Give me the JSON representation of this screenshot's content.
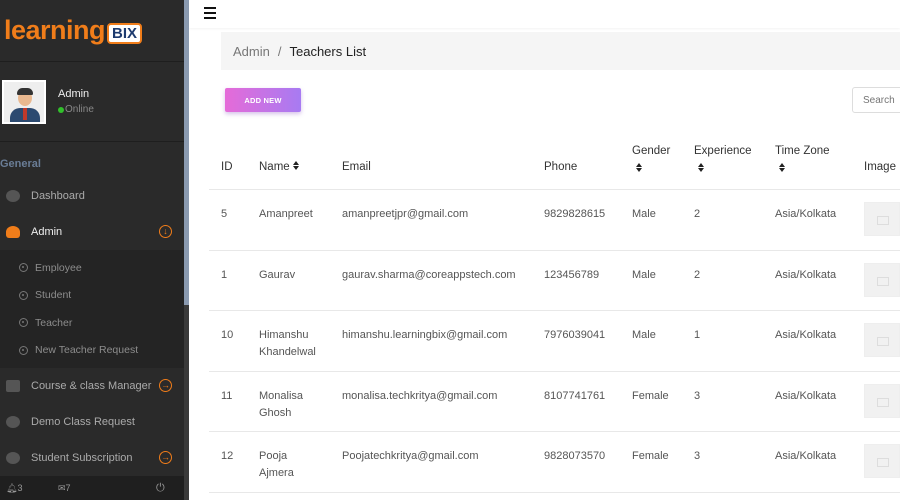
{
  "brand": {
    "part1": "learning",
    "part2": "BIX"
  },
  "profile": {
    "name": "Admin",
    "status": "Online"
  },
  "sidebar": {
    "section": "General",
    "items": [
      {
        "label": "Dashboard"
      },
      {
        "label": "Admin"
      }
    ],
    "admin_sub": [
      {
        "label": "Employee"
      },
      {
        "label": "Student"
      },
      {
        "label": "Teacher"
      },
      {
        "label": "New Teacher Request"
      }
    ],
    "more": [
      {
        "label": "Course & class Manager"
      },
      {
        "label": "Demo Class Request"
      },
      {
        "label": "Student Subscription"
      }
    ],
    "footer": {
      "notifications": "3",
      "messages": "7"
    }
  },
  "breadcrumb": {
    "root": "Admin",
    "separator": "/",
    "current": "Teachers List"
  },
  "toolbar": {
    "add_new": "ADD NEW",
    "search_placeholder": "Search"
  },
  "table": {
    "headers": {
      "id": "ID",
      "name": "Name",
      "email": "Email",
      "phone": "Phone",
      "gender": "Gender",
      "experience": "Experience",
      "timezone": "Time Zone",
      "image": "Image"
    },
    "rows": [
      {
        "id": "5",
        "name1": "Amanpreet",
        "name2": "",
        "email": "amanpreetjpr@gmail.com",
        "phone": "9829828615",
        "gender": "Male",
        "experience": "2",
        "timezone": "Asia/Kolkata"
      },
      {
        "id": "1",
        "name1": "Gaurav",
        "name2": "",
        "email": "gaurav.sharma@coreappstech.com",
        "phone": "123456789",
        "gender": "Male",
        "experience": "2",
        "timezone": "Asia/Kolkata"
      },
      {
        "id": "10",
        "name1": "Himanshu",
        "name2": "Khandelwal",
        "email": "himanshu.learningbix@gmail.com",
        "phone": "7976039041",
        "gender": "Male",
        "experience": "1",
        "timezone": "Asia/Kolkata"
      },
      {
        "id": "11",
        "name1": "Monalisa",
        "name2": "Ghosh",
        "email": "monalisa.techkritya@gmail.com",
        "phone": "8107741761",
        "gender": "Female",
        "experience": "3",
        "timezone": "Asia/Kolkata"
      },
      {
        "id": "12",
        "name1": "Pooja",
        "name2": "Ajmera",
        "email": "Poojatechkritya@gmail.com",
        "phone": "9828073570",
        "gender": "Female",
        "experience": "3",
        "timezone": "Asia/Kolkata"
      }
    ]
  }
}
